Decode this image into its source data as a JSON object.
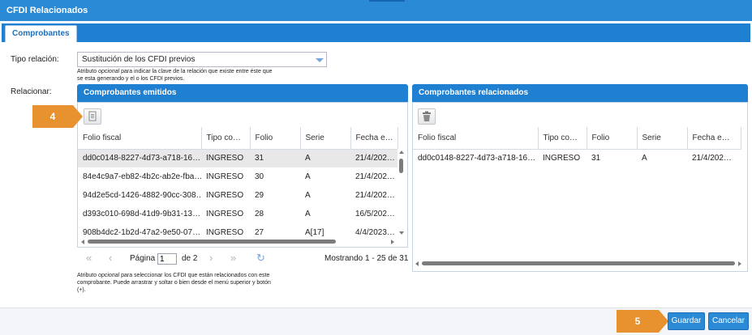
{
  "window": {
    "title": "CFDI Relacionados"
  },
  "tabs": [
    {
      "label": "Comprobantes"
    }
  ],
  "form": {
    "tipo_relacion_label": "Tipo relación:",
    "tipo_relacion_value": "Sustitución de los CFDI previos",
    "tipo_relacion_help_pre": "Atributo ",
    "tipo_relacion_help_em": "opcional",
    "tipo_relacion_help_line1_post": " para indicar la clave de la relación que existe entre éste que",
    "tipo_relacion_help_line2": "se esta generando y el o los CFDI previos.",
    "relacionar_label": "Relacionar:"
  },
  "emitidos": {
    "title": "Comprobantes emitidos",
    "columns": [
      "Folio fiscal",
      "Tipo co…",
      "Folio",
      "Serie",
      "Fecha e…"
    ],
    "rows": [
      [
        "dd0c0148-8227-4d73-a718-16…",
        "INGRESO",
        "31",
        "A",
        "21/4/202…"
      ],
      [
        "84e4c9a7-eb82-4b2c-ab2e-fba…",
        "INGRESO",
        "30",
        "A",
        "21/4/202…"
      ],
      [
        "94d2e5cd-1426-4882-90cc-308…",
        "INGRESO",
        "29",
        "A",
        "21/4/202…"
      ],
      [
        "d393c010-698d-41d9-9b31-13…",
        "INGRESO",
        "28",
        "A",
        "16/5/202…"
      ],
      [
        "908b4dc2-1b2d-47a2-9e50-07…",
        "INGRESO",
        "27",
        "A[17]",
        "4/4/2023…"
      ]
    ],
    "pager": {
      "page_label": "Página",
      "page_value": "1",
      "of_label": "de 2",
      "showing": "Mostrando 1 - 25 de 31"
    },
    "help_pre": "Atributo ",
    "help_em": "opcional",
    "help_line1_post": " para seleccionar los CFDI que están relacionados con este",
    "help_line2": "comprobante. Puede arrastrar y soltar o bien desde el menú superior y botón",
    "help_line3": "(+)."
  },
  "relacionados": {
    "title": "Comprobantes relacionados",
    "columns": [
      "Folio fiscal",
      "Tipo co…",
      "Folio",
      "Serie",
      "Fecha e…"
    ],
    "rows": [
      [
        "dd0c0148-8227-4d73-a718-16…",
        "INGRESO",
        "31",
        "A",
        "21/4/202…"
      ]
    ]
  },
  "callouts": {
    "step_add": "4",
    "step_save": "5"
  },
  "buttons": {
    "save": "Guardar",
    "cancel": "Cancelar"
  },
  "icons": {
    "add": "add-document-icon",
    "delete": "trash-icon",
    "first": "first-page-icon",
    "prev": "prev-page-icon",
    "next": "next-page-icon",
    "last": "last-page-icon",
    "refresh": "refresh-icon"
  },
  "colors": {
    "header_blue": "#2b8ad6",
    "callout_orange": "#e8912f"
  }
}
